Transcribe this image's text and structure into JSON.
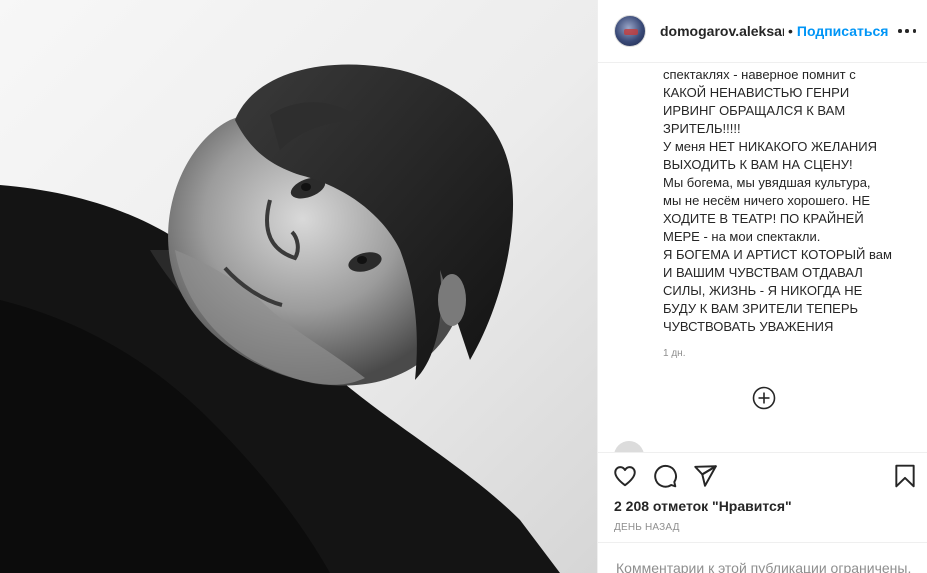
{
  "header": {
    "username": "domogarov.aleksan",
    "separator": "•",
    "follow_label": "Подписаться"
  },
  "caption": {
    "lines": [
      "спектаклях - наверное помнит с",
      "КАКОЙ НЕНАВИСТЬЮ ГЕНРИ",
      "ИРВИНГ ОБРАЩАЛСЯ К ВАМ",
      "ЗРИТЕЛЬ!!!!!",
      "У меня НЕТ НИКАКОГО ЖЕЛАНИЯ",
      "ВЫХОДИТЬ К ВАМ НА СЦЕНУ!",
      "Мы богема, мы увядшая культура,",
      "мы не несём ничего хорошего. НЕ",
      "ХОДИТЕ В ТЕАТР! ПО КРАЙНЕЙ",
      "МЕРЕ - на мои спектакли.",
      "Я БОГЕМА И АРТИСТ КОТОРЫЙ вам",
      "И ВАШИМ ЧУВСТВАМ ОТДАВАЛ",
      "СИЛЫ, ЖИЗНЬ - Я НИКОГДА НЕ",
      "БУДУ К ВАМ ЗРИТЕЛИ ТЕПЕРЬ",
      "ЧУВСТВОВАТЬ УВАЖЕНИЯ"
    ],
    "time": "1 дн."
  },
  "icons": {
    "load_more": "plus-circle-icon",
    "like": "heart-icon",
    "comment": "comment-bubble-icon",
    "share": "paper-plane-icon",
    "save": "bookmark-icon",
    "more": "more-options-icon"
  },
  "stats": {
    "likes": "2 208 отметок \"Нравится\"",
    "date": "ДЕНЬ НАЗАД"
  },
  "footer": {
    "comments_restricted": "Комментарии к этой публикации ограничены."
  },
  "colors": {
    "accent": "#0095f6",
    "text": "#262626",
    "secondary": "#8e8e8e",
    "border": "#efefef"
  }
}
